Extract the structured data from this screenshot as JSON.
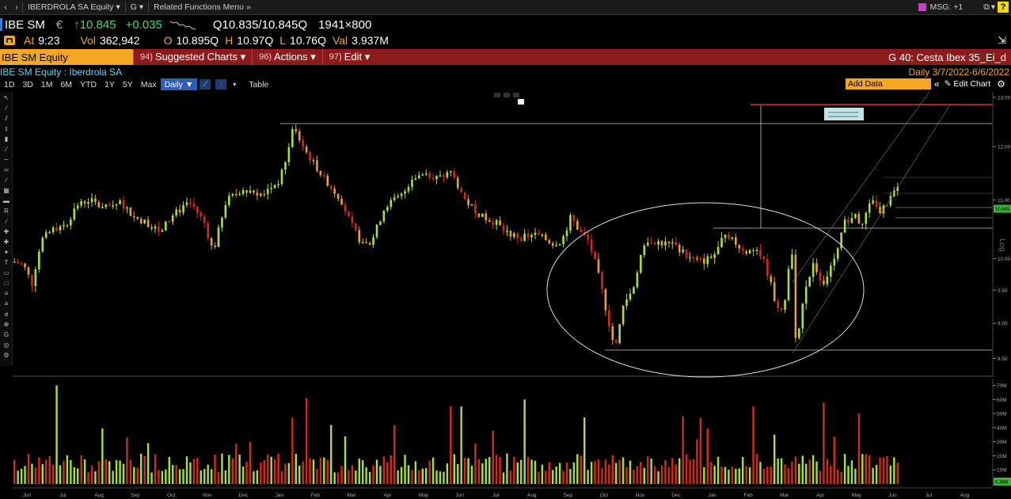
{
  "navbar": {
    "back_arrow": "‹",
    "forward_arrow": "›",
    "security_menu": "IBERDROLA SA Equity ▾",
    "g_menu": "G ▾",
    "related": "Related Functions Menu »",
    "msg": "MSG: +1",
    "help": "?"
  },
  "quote": {
    "ticker": "IBE SM",
    "currency": "€",
    "last": "↑10.845",
    "change": "+0.035",
    "bid_ask": "Q10.835/10.845Q",
    "size": "1941×800",
    "time_label": "At",
    "time": "9:23",
    "vol_label": "Vol",
    "vol": "362,942",
    "open_label": "O",
    "open": "10.895Q",
    "high_label": "H",
    "high": "10.97Q",
    "low_label": "L",
    "low": "10.76Q",
    "val_label": "Val",
    "val": "3.937M"
  },
  "funcbar": {
    "security": "IBE SM Equity",
    "suggested_num": "94)",
    "suggested": "Suggested Charts ▾",
    "actions_num": "96)",
    "actions": "Actions ▾",
    "edit_num": "97)",
    "edit": "Edit ▾",
    "right": "G 40: Cesta Ibex 35_Ei_d"
  },
  "sectitle": {
    "name": "IBE SM Equity : Iberdrola SA",
    "right": "Daily   3/7/2022-6/6/2022"
  },
  "toolbar": {
    "ranges": [
      "1D",
      "3D",
      "1M",
      "6M",
      "YTD",
      "1Y",
      "5Y",
      "Max"
    ],
    "period": "Daily ▼",
    "table": "Table",
    "add_data": "Add Data",
    "collapse": "«",
    "edit_chart": "✎ Edit Chart",
    "settings_icon": "⚙"
  },
  "chart": {
    "price_ticks": [
      "13.00",
      "12.00",
      "11.00",
      "10.00",
      "9.50",
      "9.00",
      "8.50"
    ],
    "last_price_tag": "10.845",
    "vol_ticks": [
      "70M",
      "60M",
      "50M",
      "40M",
      "30M",
      "20M",
      "10M"
    ],
    "last_vol_tag": "6.36M",
    "months": [
      "Jun",
      "Jul",
      "Aug",
      "Sep",
      "Oct",
      "Nov",
      "Dec",
      "Jan",
      "Feb",
      "Mar",
      "Apr",
      "May",
      "Jun",
      "Jul",
      "Aug",
      "Sep",
      "Oct",
      "Nov",
      "Dec",
      "Jan",
      "Feb",
      "Mar",
      "Apr",
      "May",
      "Jun",
      "Jul",
      "Aug"
    ],
    "axis_mode": "Log",
    "colors": {
      "up": "#a8e040",
      "down": "#d42a1a",
      "ochre": "#e8a030",
      "line": "#c8c8c8",
      "redline": "#e03030"
    }
  }
}
